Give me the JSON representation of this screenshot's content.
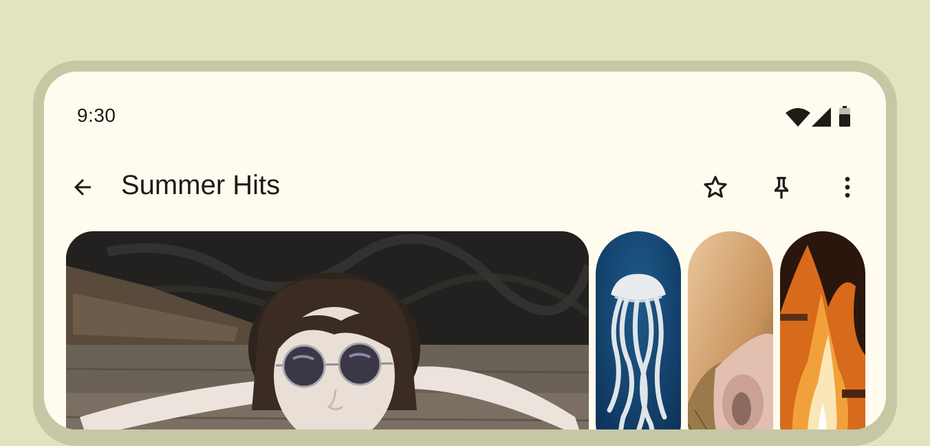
{
  "status_bar": {
    "time": "9:30",
    "icons": [
      "wifi-icon",
      "signal-icon",
      "battery-icon"
    ]
  },
  "top_app_bar": {
    "back_icon": "arrow-back-icon",
    "title": "Summer Hits",
    "actions": [
      "star-icon",
      "pin-icon",
      "more-vert-icon"
    ]
  },
  "carousel": {
    "items": [
      {
        "name": "hero-photo-person-sunglasses"
      },
      {
        "name": "photo-jellyfish"
      },
      {
        "name": "photo-animal-nose"
      },
      {
        "name": "photo-fire"
      }
    ]
  },
  "colors": {
    "background": "#e4e3c0",
    "frame": "#c6c8a4",
    "surface": "#fffbef",
    "on_surface": "#1d1c16"
  }
}
